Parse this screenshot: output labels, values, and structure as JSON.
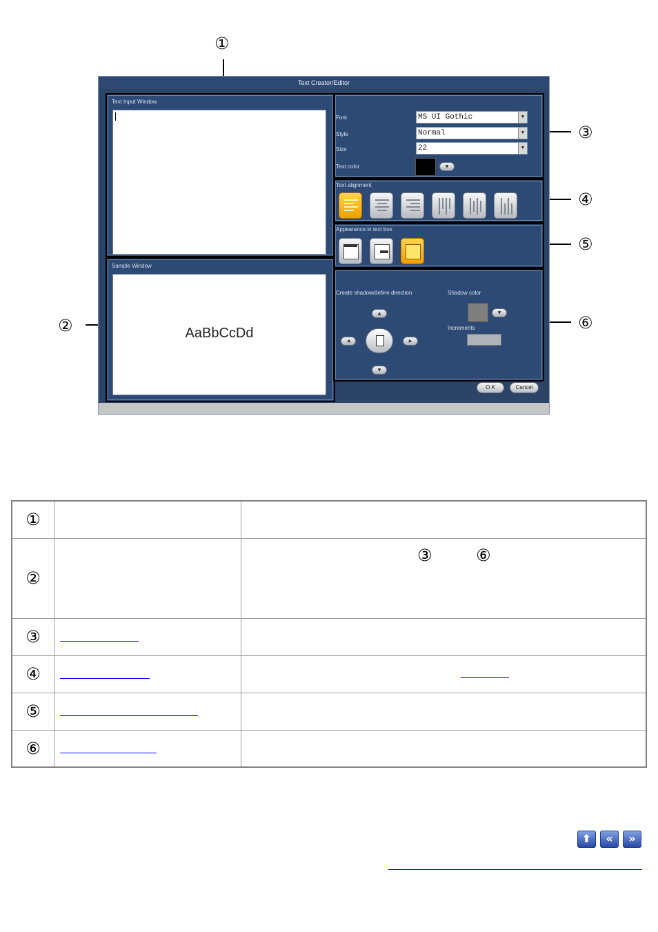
{
  "dialog": {
    "title": "Text Creator/Editor",
    "text_input_label": "Text Input Window",
    "sample_label": "Sample Window",
    "sample_text": "AaBbCcDd",
    "font_label": "Font",
    "font_value": "MS UI Gothic",
    "style_label": "Style",
    "style_value": "Normal",
    "size_label": "Size",
    "size_value": "22",
    "text_color_label": "Text color",
    "text_color": "#000000",
    "alignment_label": "Text alignment",
    "appearance_label": "Appearance in text box",
    "shadow_direction_label": "Create shadow/define direction",
    "shadow_color_label": "Shadow color",
    "shadow_color": "#7f7f7f",
    "increments_label": "Increments",
    "ok_label": "O K",
    "cancel_label": "Cancel"
  },
  "callouts": [
    "①",
    "②",
    "③",
    "④",
    "⑤",
    "⑥"
  ],
  "table": {
    "rows": [
      {
        "num": "①",
        "name": "",
        "desc": ""
      },
      {
        "num": "②",
        "name": "",
        "desc_refs": [
          "③",
          "⑥"
        ]
      },
      {
        "num": "③",
        "name": "",
        "desc": ""
      },
      {
        "num": "④",
        "name": "",
        "desc": ""
      },
      {
        "num": "⑤",
        "name": "",
        "desc": ""
      },
      {
        "num": "⑥",
        "name": "",
        "desc": ""
      }
    ]
  },
  "icons": {
    "up": "arrow-up-icon",
    "prev": "double-chevron-left-icon",
    "next": "double-chevron-right-icon"
  }
}
